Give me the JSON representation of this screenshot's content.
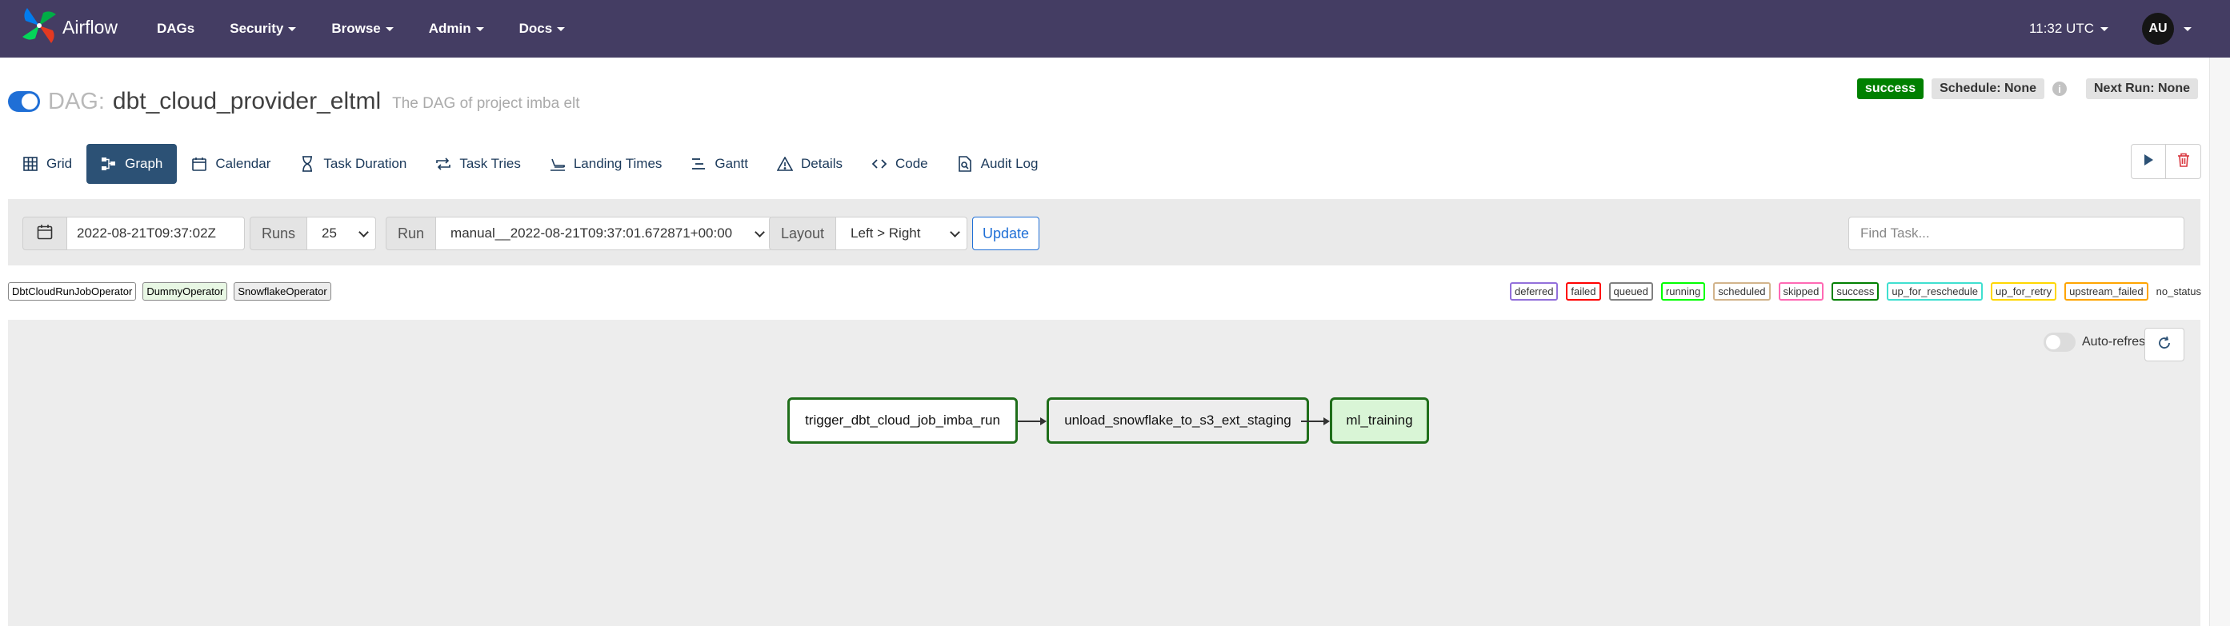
{
  "navbar": {
    "brand": "Airflow",
    "items": [
      {
        "label": "DAGs",
        "dropdown": false
      },
      {
        "label": "Security",
        "dropdown": true
      },
      {
        "label": "Browse",
        "dropdown": true
      },
      {
        "label": "Admin",
        "dropdown": true
      },
      {
        "label": "Docs",
        "dropdown": true
      }
    ],
    "clock": "11:32 UTC",
    "user_initials": "AU"
  },
  "header": {
    "dag_prefix": "DAG:",
    "dag_id": "dbt_cloud_provider_eltml",
    "description": "The DAG of project imba elt",
    "state": "success",
    "schedule": "Schedule: None",
    "next_run": "Next Run: None",
    "info_glyph": "i"
  },
  "tabs": [
    {
      "label": "Grid",
      "icon": "grid-icon"
    },
    {
      "label": "Graph",
      "icon": "graph-icon",
      "active": true
    },
    {
      "label": "Calendar",
      "icon": "calendar-icon"
    },
    {
      "label": "Task Duration",
      "icon": "hourglass-icon"
    },
    {
      "label": "Task Tries",
      "icon": "retry-icon"
    },
    {
      "label": "Landing Times",
      "icon": "landing-icon"
    },
    {
      "label": "Gantt",
      "icon": "gantt-icon"
    },
    {
      "label": "Details",
      "icon": "details-icon"
    },
    {
      "label": "Code",
      "icon": "code-icon"
    },
    {
      "label": "Audit Log",
      "icon": "audit-log-icon"
    }
  ],
  "filters": {
    "date": "2022-08-21T09:37:02Z",
    "runs_label": "Runs",
    "runs_value": "25",
    "run_label": "Run",
    "run_value": "manual__2022-08-21T09:37:01.672871+00:00",
    "layout_label": "Layout",
    "layout_value": "Left > Right",
    "update_label": "Update",
    "find_task_placeholder": "Find Task..."
  },
  "operators": [
    {
      "label": "DbtCloudRunJobOperator",
      "color": "#ffffff"
    },
    {
      "label": "DummyOperator",
      "color": "#e8f7e4"
    },
    {
      "label": "SnowflakeOperator",
      "color": "#ededed"
    }
  ],
  "states": [
    {
      "label": "deferred",
      "color": "#9370db"
    },
    {
      "label": "failed",
      "color": "#ff0000"
    },
    {
      "label": "queued",
      "color": "#808080"
    },
    {
      "label": "running",
      "color": "#00ff00"
    },
    {
      "label": "scheduled",
      "color": "#d2b48c"
    },
    {
      "label": "skipped",
      "color": "#ff69b4"
    },
    {
      "label": "success",
      "color": "#008000"
    },
    {
      "label": "up_for_reschedule",
      "color": "#40e0d0"
    },
    {
      "label": "up_for_retry",
      "color": "#ffd700"
    },
    {
      "label": "upstream_failed",
      "color": "#ffa500"
    },
    {
      "label": "no_status",
      "color": ""
    }
  ],
  "graph": {
    "auto_refresh_label": "Auto-refresh",
    "nodes": [
      {
        "id": "trigger_dbt_cloud_job_imba_run",
        "status": "success"
      },
      {
        "id": "unload_snowflake_to_s3_ext_staging",
        "status": "success"
      },
      {
        "id": "ml_training",
        "status": "success"
      }
    ]
  }
}
